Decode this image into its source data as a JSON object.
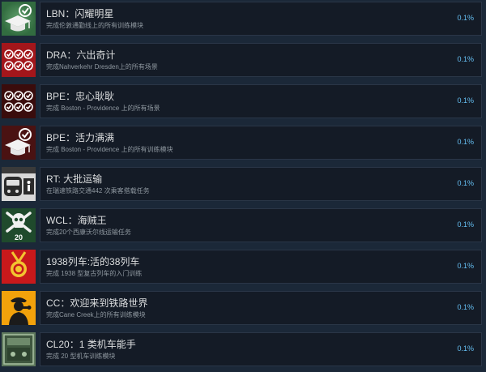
{
  "achievements": [
    {
      "title": "LBN：闪耀明星",
      "desc": "完成伦敦通勤线上的所有训练模块",
      "percent": "0.1%",
      "icon": "graduation-cap-check-icon"
    },
    {
      "title": "DRA：六出奇计",
      "desc": "完成Nahverkehr Dresden上的所有场景",
      "percent": "0.1%",
      "icon": "six-checks-icon"
    },
    {
      "title": "BPE：忠心耿耿",
      "desc": "完成 Boston - Providence 上的所有场景",
      "percent": "0.1%",
      "icon": "six-checks-icon"
    },
    {
      "title": "BPE：活力满满",
      "desc": "完成 Boston - Providence 上的所有训练模块",
      "percent": "0.1%",
      "icon": "graduation-cap-check-icon"
    },
    {
      "title": "RT: 大批运输",
      "desc": "在瑞速铁路交通442 次乘客搭载任务",
      "percent": "0.1%",
      "icon": "train-passenger-icon"
    },
    {
      "title": "WCL：海贼王",
      "desc": "完成20个西康沃尔线运输任务",
      "percent": "0.1%",
      "icon": "skull-crossbones-icon",
      "badge": "20"
    },
    {
      "title": "1938列车:活的38列车",
      "desc": "完成 1938 型复古列车的入门训练",
      "percent": "0.1%",
      "icon": "medal-icon"
    },
    {
      "title": "CC：欢迎来到铁路世界",
      "desc": "完成Cane Creek上的所有训练模块",
      "percent": "0.1%",
      "icon": "conductor-whistle-icon"
    },
    {
      "title": "CL20：1 类机车能手",
      "desc": "完成 20 型机车训练模块",
      "percent": "0.1%",
      "icon": "locomotive-plate-icon"
    }
  ],
  "colors": {
    "background": "#1b2838",
    "panel": "#141b26",
    "title": "#dcdedf",
    "desc": "#8f98a0",
    "percent": "#66c0f4"
  }
}
